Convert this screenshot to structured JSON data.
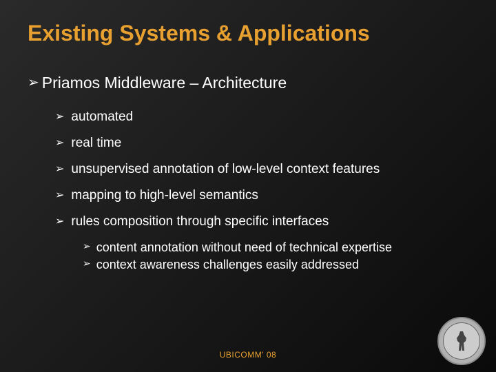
{
  "title": "Existing Systems & Applications",
  "mainBullet": "Priamos Middleware – Architecture",
  "subBullets": {
    "b0": "automated",
    "b1": "real time",
    "b2": "unsupervised annotation of low-level context features",
    "b3": "mapping to high-level semantics",
    "b4": "rules composition through specific interfaces"
  },
  "subSubBullets": {
    "s0": "content annotation without need of technical expertise",
    "s1": "context awareness challenges easily addressed"
  },
  "footer": "UBICOMM' 08"
}
